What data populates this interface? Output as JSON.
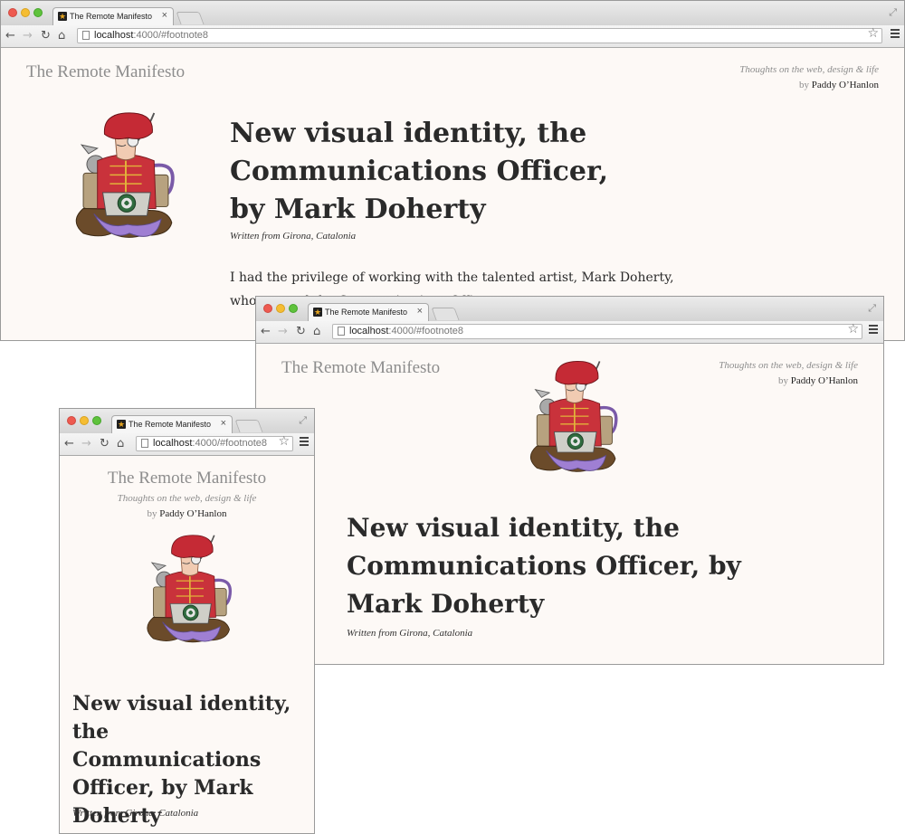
{
  "browser": {
    "tab_title": "The Remote Manifesto",
    "tab_favicon": "star-favicon",
    "url_host": "localhost",
    "url_path": ":4000/#footnote8",
    "icons": [
      "back-arrow-icon",
      "forward-arrow-icon",
      "reload-icon",
      "home-icon",
      "star-icon",
      "menu-icon",
      "close-icon",
      "resize-icon"
    ]
  },
  "site": {
    "title": "The Remote Manifesto",
    "tagline": "Thoughts on the web, design & life",
    "by": "by",
    "author": "Paddy O’Hanlon"
  },
  "article": {
    "title": "New visual identity, the Communications Officer, by Mark Doherty",
    "written_from": "Written from Girona, Catalonia",
    "paragraph": "I had the privilege of working with the talented artist, Mark Doherty, who created the Communications Officer"
  },
  "colors": {
    "page_background": "#fdf9f6",
    "site_title": "#8d8d8d",
    "headline": "#2a2a2a",
    "chrome_frame": "#d4d4d4"
  }
}
